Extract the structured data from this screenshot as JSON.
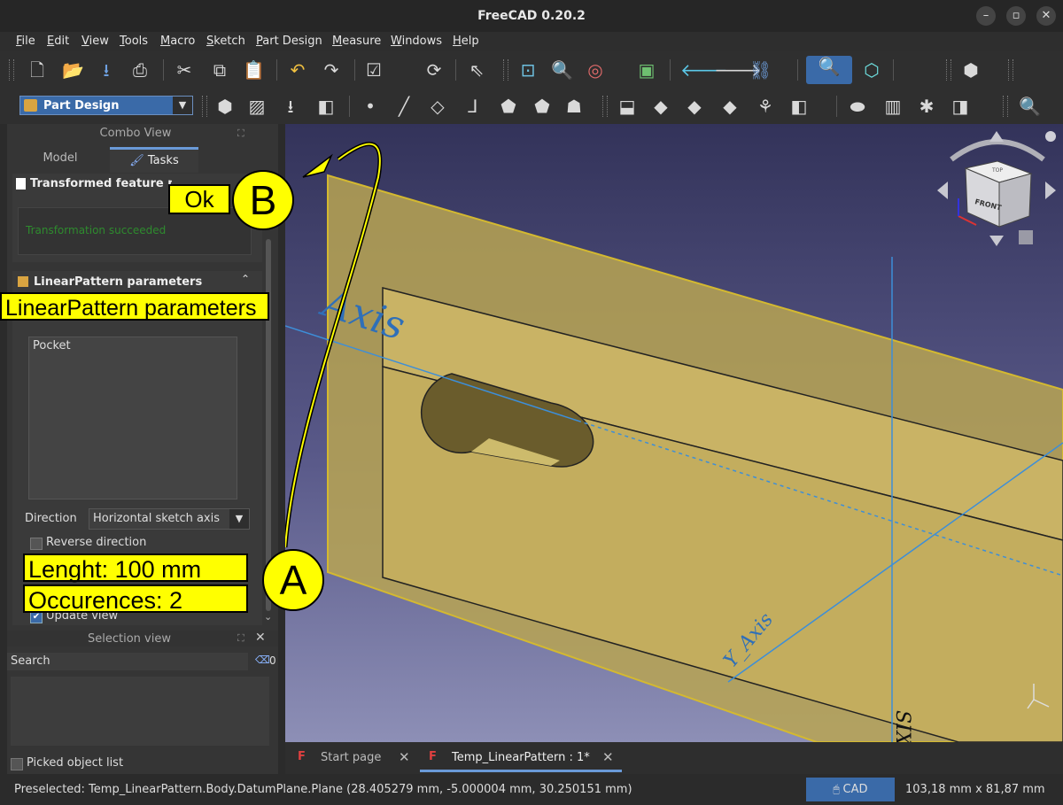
{
  "window": {
    "title": "FreeCAD 0.20.2",
    "min": "–",
    "max": "▫",
    "close": "✕"
  },
  "menu": [
    "File",
    "Edit",
    "View",
    "Tools",
    "Macro",
    "Sketch",
    "Part Design",
    "Measure",
    "Windows",
    "Help"
  ],
  "workbench": {
    "selected": "Part Design"
  },
  "combo_view": {
    "title": "Combo View",
    "tabs": [
      "Model",
      "Tasks"
    ],
    "active_tab": "Tasks",
    "transformed_section": {
      "title": "Transformed feature messages",
      "message": "Transformation succeeded"
    },
    "linear_section": {
      "title": "LinearPattern parameters",
      "features": [
        "Pocket"
      ],
      "direction_label": "Direction",
      "direction_value": "Horizontal sketch axis",
      "reverse_label": "Reverse direction",
      "update_label": "Update view"
    }
  },
  "selection_view": {
    "title": "Selection view",
    "search_label": "Search",
    "count": "0",
    "picked_label": "Picked object list"
  },
  "annotations": {
    "ok": "Ok",
    "b": "B",
    "a": "A",
    "linear_label": "LinearPattern parameters",
    "length": "Lenght: 100 mm",
    "occurrences": "Occurences:  2"
  },
  "viewport": {
    "axis_label_1": "Axis",
    "axis_label_2": "Y_Axis",
    "axis_label_3": "SIX",
    "nav_cube_face": "FRONT",
    "nav_cube_top": "TOP"
  },
  "doc_tabs": [
    {
      "label": "Start page",
      "active": false
    },
    {
      "label": "Temp_LinearPattern : 1*",
      "active": true
    }
  ],
  "status": {
    "preselected": "Preselected: Temp_LinearPattern.Body.DatumPlane.Plane (28.405279 mm, -5.000004 mm, 30.250151 mm)",
    "nav_style": "CAD",
    "dimensions": "103,18 mm x 81,87 mm"
  },
  "colors": {
    "accent": "#3a6aa8",
    "callout": "#ffff00",
    "success": "#2e8b2e",
    "record": "#e53935",
    "plane": "#b8a552"
  }
}
